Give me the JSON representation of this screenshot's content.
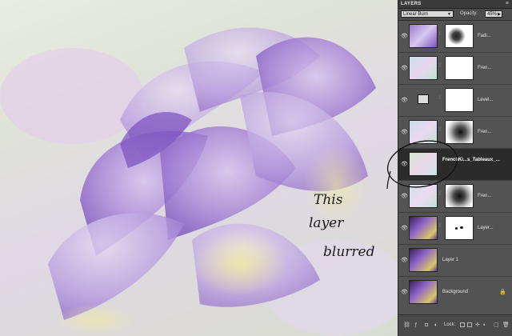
{
  "panel": {
    "tab_title": "LAYERS",
    "blend_mode": "Linear Burn",
    "opacity_label": "Opacity:",
    "opacity_value": "45%",
    "layers": [
      {
        "name": "Fadi...",
        "thumb": "thumb-purple-texture",
        "mask": "mask-black-white-splotch",
        "visible": true,
        "selected": false
      },
      {
        "name": "Fren...",
        "thumb": "thumb-pastel-texture",
        "mask": "mask-white",
        "visible": true,
        "selected": false
      },
      {
        "name": "Level...",
        "thumb": "thumb-levels-adjustment",
        "mask": "mask-white",
        "visible": true,
        "selected": false
      },
      {
        "name": "Fren...",
        "thumb": "thumb-pastel-texture",
        "mask": "mask-black-smudge",
        "visible": true,
        "selected": false
      },
      {
        "name": "FrenchKi...s_Tableaux_...",
        "thumb": "thumb-pastel-gradient",
        "mask": "",
        "visible": true,
        "selected": true
      },
      {
        "name": "Fren...",
        "thumb": "thumb-pastel-texture",
        "mask": "mask-black-smudge",
        "visible": true,
        "selected": false
      },
      {
        "name": "Layer...",
        "thumb": "thumb-purple-flower",
        "mask": "mask-white-dots",
        "visible": true,
        "selected": false
      },
      {
        "name": "Layer 1",
        "thumb": "thumb-purple-flower",
        "mask": "",
        "visible": true,
        "selected": false
      },
      {
        "name": "Background",
        "thumb": "thumb-purple-flower",
        "mask": "",
        "visible": true,
        "selected": false,
        "locked": true
      }
    ],
    "lock_label": "Lock:"
  },
  "annotation": {
    "line1": "This",
    "line2": "layer",
    "line3": "blurred"
  },
  "colors": {
    "panel_bg": "#535353",
    "selected_row": "#2b2b2b",
    "flower_purple": "#8e63c8",
    "flower_light": "#c9b2e6",
    "flower_yellow": "#e8e39a"
  }
}
